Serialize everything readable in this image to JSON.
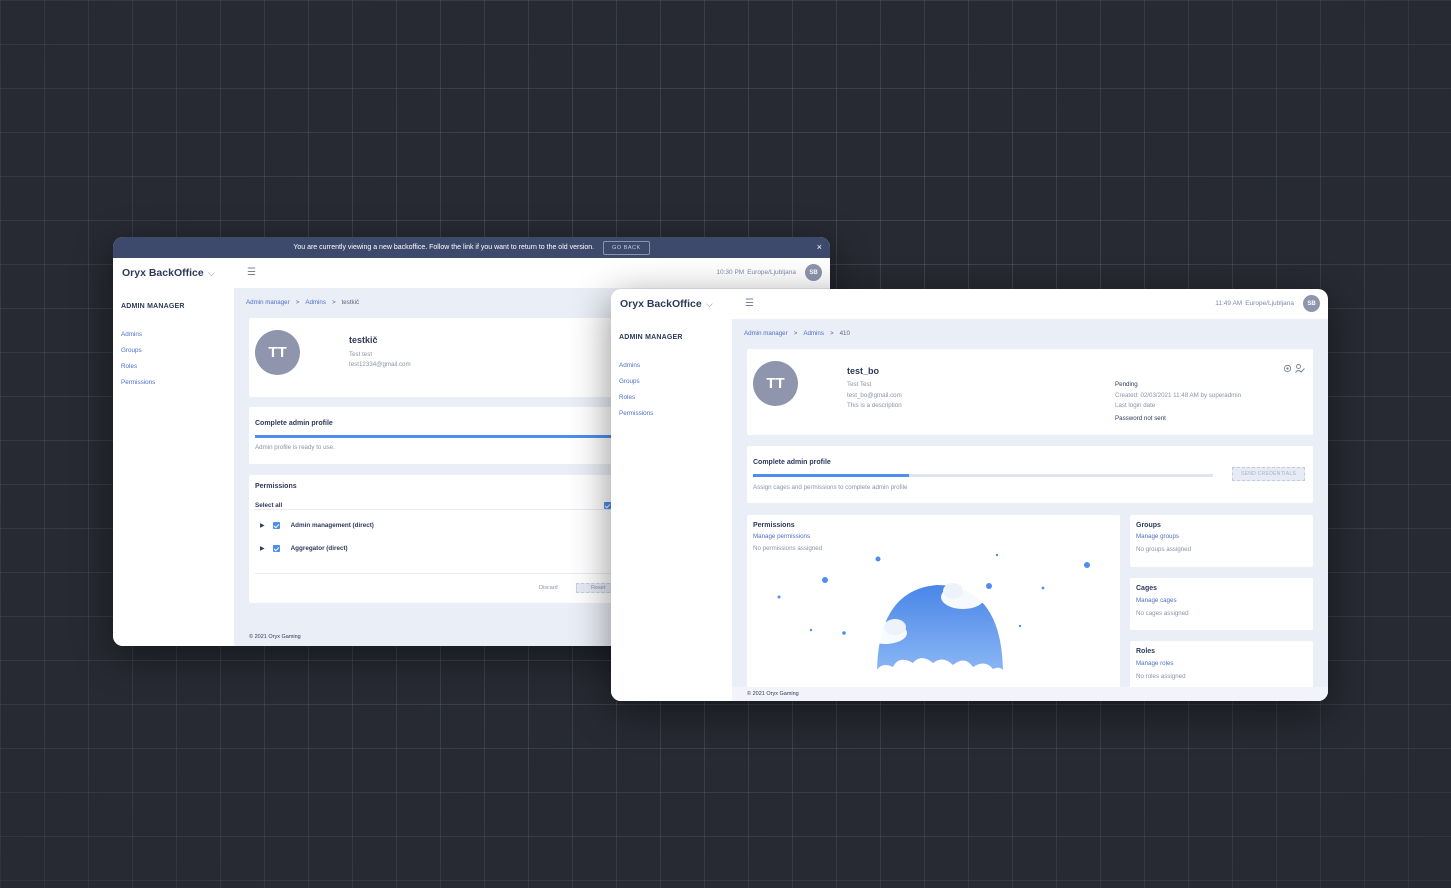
{
  "colors": {
    "background": "#272a33",
    "accent": "#4d8ef0",
    "banner": "#3e4a6b",
    "link": "#4d6fc4"
  },
  "window1": {
    "banner": {
      "text": "You are currently viewing a new backoffice. Follow the link if you want to return to the old version.",
      "go_back": "GO BACK",
      "close": "×"
    },
    "topbar": {
      "logo": "Oryx BackOffice",
      "chevron": "⌵",
      "menu": "☰",
      "time": "10:30 PM",
      "timezone": "Europe/Ljubljana",
      "avatar": "SB"
    },
    "sidebar": {
      "heading": "ADMIN MANAGER",
      "items": [
        {
          "label": "Admins"
        },
        {
          "label": "Groups"
        },
        {
          "label": "Roles"
        },
        {
          "label": "Permissions"
        }
      ]
    },
    "breadcrumb": {
      "items": [
        "Admin manager",
        "Admins"
      ],
      "separator": ">",
      "current": "testkič"
    },
    "profile": {
      "initials": "TT",
      "name": "testkič",
      "fullname": "Test test",
      "email": "test12334@gmail.com"
    },
    "complete": {
      "title": "Complete admin profile",
      "progress": 1.0,
      "status": "Admin profile is ready to use."
    },
    "permissions": {
      "title": "Permissions",
      "select_all": "Select all",
      "items": [
        {
          "label": "Admin management (direct)"
        },
        {
          "label": "Aggregator (direct)"
        }
      ],
      "discard": "Discard",
      "reset": "Reset"
    },
    "footer": "© 2021 Oryx Gaming"
  },
  "window2": {
    "topbar": {
      "logo": "Oryx BackOffice",
      "chevron": "⌵",
      "menu": "☰",
      "time": "11:49 AM",
      "timezone": "Europe/Ljubljana",
      "avatar": "SB"
    },
    "sidebar": {
      "heading": "ADMIN MANAGER",
      "items": [
        {
          "label": "Admins"
        },
        {
          "label": "Groups"
        },
        {
          "label": "Roles"
        },
        {
          "label": "Permissions"
        }
      ]
    },
    "breadcrumb": {
      "items": [
        "Admin manager",
        "Admins"
      ],
      "separator": ">",
      "current": "410"
    },
    "profile": {
      "initials": "TT",
      "name": "test_bo",
      "fullname": "Test Test",
      "email": "test_bo@gmail.com",
      "description": "This is a description",
      "status": "Pending",
      "created": "Created: 02/03/2021 11:48 AM by superadmin",
      "last_login": "Last login date",
      "password": "Password not sent",
      "icons": [
        "settings-icon",
        "edit-user-icon"
      ]
    },
    "complete": {
      "title": "Complete admin profile",
      "progress": 0.34,
      "status": "Assign cages and permissions to complete admin profile",
      "send_button": "SEND CREDENTIALS"
    },
    "permissions": {
      "title": "Permissions",
      "manage": "Manage permissions",
      "empty": "No permissions assigned"
    },
    "groups": {
      "title": "Groups",
      "manage": "Manage groups",
      "empty": "No groups assigned"
    },
    "cages": {
      "title": "Cages",
      "manage": "Manage cages",
      "empty": "No cages assigned"
    },
    "roles": {
      "title": "Roles",
      "manage": "Manage roles",
      "empty": "No roles assigned"
    },
    "footer": "© 2021 Oryx Gaming"
  }
}
